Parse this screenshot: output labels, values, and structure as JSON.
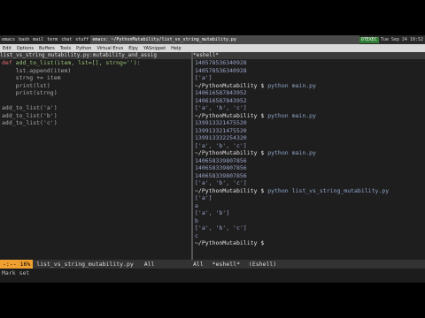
{
  "taskbar": {
    "tasks": [
      "emacs",
      "bash",
      "mail",
      "term",
      "chat",
      "stuff"
    ],
    "window_title": "emacs: ~/PythonMutability/list_vs_string_mutability.py",
    "tray_label": "OTEXEC",
    "clock": "Tue Sep 24  10:52"
  },
  "menubar": {
    "items": [
      "Edit",
      "Options",
      "Buffers",
      "Tools",
      "Python",
      "Virtual Envs",
      "Elpy",
      "YASnippet",
      "Help"
    ]
  },
  "editor": {
    "header": "list_vs_string_mutability.py:mutability_and_assig",
    "code": [
      "def add_to_list(item, lst=[], strng=''):",
      "    lst.append(item)",
      "    strng += item",
      "    print(lst)",
      "    print(strng)",
      "",
      "add_to_list('a')",
      "add_to_list('b')",
      "add_to_list('c')"
    ],
    "modeline_badge": "-:-- 16%",
    "modeline_file": "list_vs_string_mutability.py",
    "modeline_pos": "All"
  },
  "eshell": {
    "header": "*eshell*",
    "lines": [
      {
        "t": "out",
        "s": "140578536340928"
      },
      {
        "t": "out",
        "s": "140578536340928"
      },
      {
        "t": "out",
        "s": "['a']"
      },
      {
        "t": "prompt",
        "s": "~/PythonMutability $ ",
        "c": "python main.py"
      },
      {
        "t": "out",
        "s": "140616587843952"
      },
      {
        "t": "out",
        "s": "140616587843952"
      },
      {
        "t": "out",
        "s": "['a', 'b', 'c']"
      },
      {
        "t": "prompt",
        "s": "~/PythonMutability $ ",
        "c": "python main.py"
      },
      {
        "t": "out",
        "s": "139913321475520"
      },
      {
        "t": "out",
        "s": "139913321475520"
      },
      {
        "t": "out",
        "s": "139913332254320"
      },
      {
        "t": "out",
        "s": "['a', 'b', 'c']"
      },
      {
        "t": "prompt",
        "s": "~/PythonMutability $ ",
        "c": "python main.py"
      },
      {
        "t": "out",
        "s": "140658339807856"
      },
      {
        "t": "out",
        "s": "140658339807856"
      },
      {
        "t": "out",
        "s": "140658339807856"
      },
      {
        "t": "out",
        "s": "['a', 'b', 'c']"
      },
      {
        "t": "prompt",
        "s": "~/PythonMutability $ ",
        "c": "python list_vs_string_mutability.py"
      },
      {
        "t": "out",
        "s": "['a']"
      },
      {
        "t": "out",
        "s": "a"
      },
      {
        "t": "out",
        "s": "['a', 'b']"
      },
      {
        "t": "out",
        "s": "b"
      },
      {
        "t": "out",
        "s": "['a', 'b', 'c']"
      },
      {
        "t": "out",
        "s": "c"
      },
      {
        "t": "prompt",
        "s": "~/PythonMutability $ ",
        "c": ""
      }
    ],
    "modeline_pos": "All",
    "modeline_name": "*eshell*",
    "modeline_mode": "(Eshell)"
  },
  "minibuffer": "Mark set"
}
